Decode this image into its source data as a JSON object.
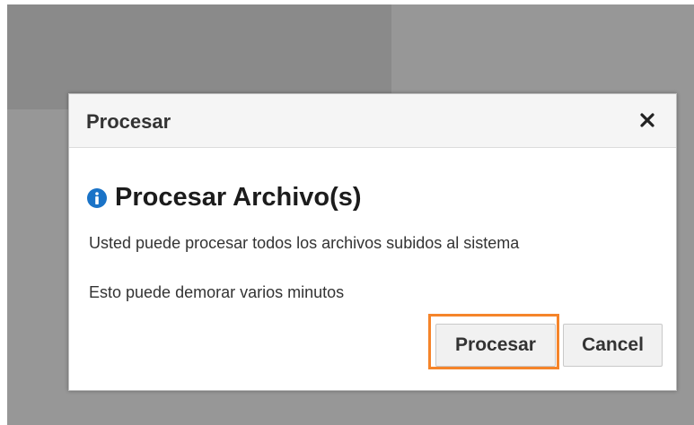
{
  "dialog": {
    "title": "Procesar",
    "heading": "Procesar Archivo(s)",
    "message_line_1": "Usted puede procesar todos los archivos subidos al sistema",
    "message_line_2": "Esto puede demorar varios minutos",
    "close_icon": "close-icon",
    "info_icon": "info-icon",
    "buttons": {
      "process_label": "Procesar",
      "cancel_label": "Cancel"
    }
  },
  "colors": {
    "info_icon": "#1a73c7",
    "highlight": "#f5842a",
    "overlay": "#979797"
  }
}
